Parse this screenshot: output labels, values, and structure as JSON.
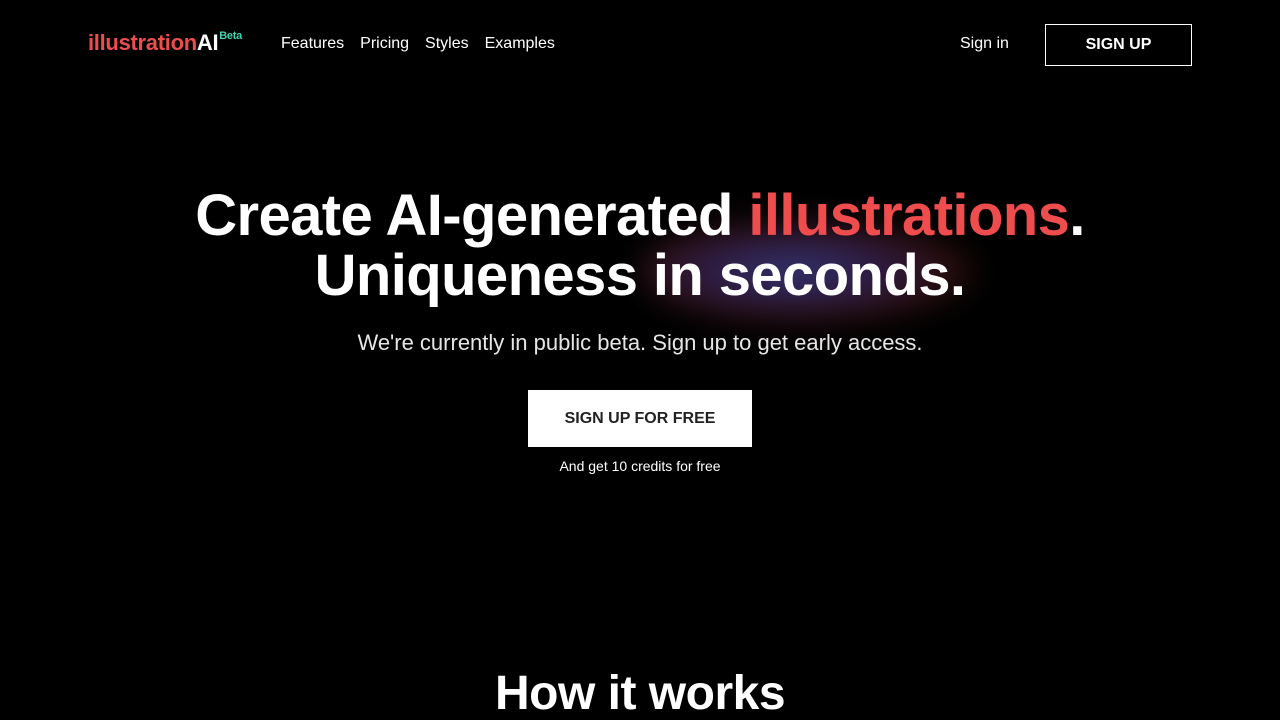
{
  "header": {
    "logo": {
      "word1": "illustration",
      "word2": "AI",
      "badge": "Beta"
    },
    "nav": [
      "Features",
      "Pricing",
      "Styles",
      "Examples"
    ],
    "signin_label": "Sign in",
    "signup_label": "SIGN UP"
  },
  "hero": {
    "line1_prefix": "Create AI-generated ",
    "line1_accent": "illustrations",
    "line1_suffix": ".",
    "line2": "Uniqueness in seconds.",
    "subtitle": "We're currently in public beta. Sign up to get early access.",
    "cta_label": "SIGN UP FOR FREE",
    "cta_note": "And get 10 credits for free"
  },
  "section": {
    "how_title": "How it works"
  },
  "colors": {
    "accent": "#ef4d4d",
    "badge": "#3ed3b0",
    "background": "#000000"
  }
}
